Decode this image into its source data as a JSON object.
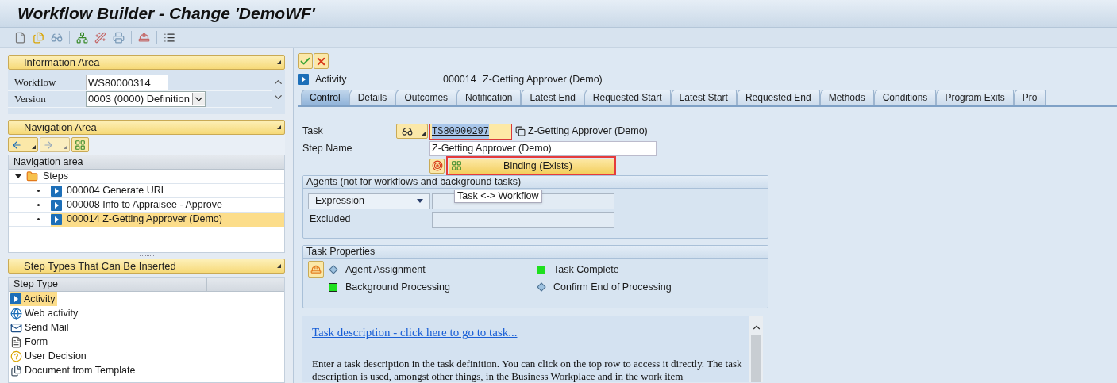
{
  "window": {
    "title": "Workflow Builder - Change 'DemoWF'"
  },
  "information_area": {
    "title": "Information Area",
    "fields": [
      {
        "label": "Workflow",
        "value": "WS80000314",
        "kind": "text"
      },
      {
        "label": "Version",
        "value": "0003 (0000) Definition",
        "kind": "dropdown"
      }
    ]
  },
  "navigation_area": {
    "title": "Navigation Area",
    "header": "Navigation area",
    "tree": [
      {
        "label": "Steps",
        "expanded": true,
        "selected": false,
        "children": [
          {
            "label": "000004 Generate URL",
            "selected": false
          },
          {
            "label": "000008 Info to Appraisee - Approve",
            "selected": false
          },
          {
            "label": "000014 Z-Getting Approver (Demo)",
            "selected": true
          }
        ]
      }
    ]
  },
  "step_types": {
    "title": "Step Types That Can Be Inserted",
    "column": "Step Type",
    "items": [
      {
        "label": "Activity",
        "kind": "activity",
        "selected": true
      },
      {
        "label": "Web activity",
        "kind": "web",
        "selected": false
      },
      {
        "label": "Send Mail",
        "kind": "mail",
        "selected": false
      },
      {
        "label": "Form",
        "kind": "form",
        "selected": false
      },
      {
        "label": "User Decision",
        "kind": "decision",
        "selected": false
      },
      {
        "label": "Document from Template",
        "kind": "document",
        "selected": false
      }
    ]
  },
  "step_header": {
    "type": "Activity",
    "number": "000014",
    "name": "Z-Getting Approver (Demo)"
  },
  "tabs": [
    {
      "label": "Control",
      "selected": true
    },
    {
      "label": "Details",
      "selected": false
    },
    {
      "label": "Outcomes",
      "selected": false
    },
    {
      "label": "Notification",
      "selected": false
    },
    {
      "label": "Latest End",
      "selected": false
    },
    {
      "label": "Requested Start",
      "selected": false
    },
    {
      "label": "Latest Start",
      "selected": false
    },
    {
      "label": "Requested End",
      "selected": false
    },
    {
      "label": "Methods",
      "selected": false
    },
    {
      "label": "Conditions",
      "selected": false
    },
    {
      "label": "Program Exits",
      "selected": false
    },
    {
      "label": "Pro",
      "selected": false
    }
  ],
  "control": {
    "task_label": "Task",
    "task_value": "TS80000297",
    "task_description": "Z-Getting Approver (Demo)",
    "step_name_label": "Step Name",
    "step_name_value": "Z-Getting Approver (Demo)",
    "binding_button": "Binding (Exists)",
    "tooltip": "Task <-> Workflow"
  },
  "agents": {
    "title": "Agents (not for workflows and background tasks)",
    "rows": [
      {
        "label": "Expression",
        "kind": "dropdown"
      },
      {
        "label": "Excluded",
        "kind": "label"
      }
    ]
  },
  "task_properties": {
    "title": "Task Properties",
    "items": [
      {
        "label": "Agent Assignment",
        "on": false
      },
      {
        "label": "Task Complete",
        "on": true
      },
      {
        "label": "Background Processing",
        "on": true
      },
      {
        "label": "Confirm End of Processing",
        "on": false
      }
    ]
  },
  "task_description": {
    "link": "Task description - click here to go to task...",
    "text": "Enter a task description in the task definition. You can click on the top row to access it directly. The task description is used, amongst other things, in the Business Workplace and in the work item"
  }
}
